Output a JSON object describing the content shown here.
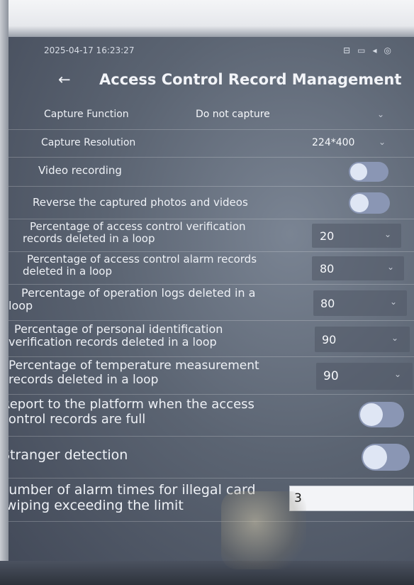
{
  "status_bar": {
    "datetime": "2025-04-17 16:23:27",
    "icons": [
      "network-icon",
      "card-icon",
      "volume-icon",
      "settings-icon"
    ]
  },
  "header": {
    "back_icon": "←",
    "title": "Access Control Record Management"
  },
  "settings": {
    "capture_function": {
      "label": "Capture Function",
      "value": "Do not capture"
    },
    "capture_resolution": {
      "label": "Capture Resolution",
      "value": "224*400"
    },
    "video_recording": {
      "label": "Video recording",
      "enabled": false
    },
    "reverse_captured": {
      "label": "Reverse the captured photos and videos",
      "enabled": false
    },
    "verification_delete_pct": {
      "label": "Percentage of access control verification records deleted in a loop",
      "value": "20"
    },
    "alarm_delete_pct": {
      "label": "Percentage of access control alarm records deleted in a loop",
      "value": "80"
    },
    "operation_logs_delete_pct": {
      "label": "Percentage of operation logs deleted in a loop",
      "value": "80"
    },
    "personal_id_delete_pct": {
      "label": "Percentage of personal identification verification records deleted in a loop",
      "value": "90"
    },
    "temperature_delete_pct": {
      "label": "Percentage of temperature measurement records deleted in a loop",
      "value": "90"
    },
    "report_when_full": {
      "label": "Report to the platform when the access control records are full",
      "enabled": false
    },
    "stranger_detection": {
      "label": "Stranger detection",
      "enabled": false
    },
    "illegal_card_alarm_times": {
      "label": "Number of alarm times for illegal card swiping exceeding the limit",
      "value": "3"
    }
  },
  "colors": {
    "background": "#5b6472",
    "toggle_off": "#8a96b4",
    "text": "#eef1f6"
  }
}
